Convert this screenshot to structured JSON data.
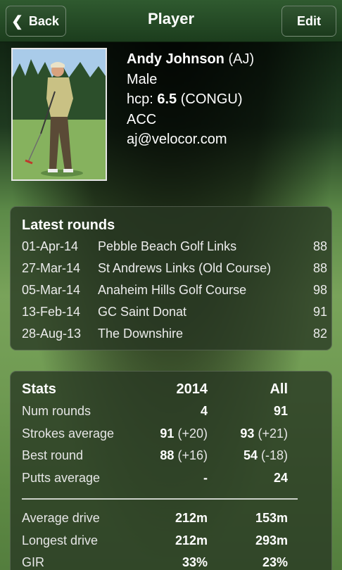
{
  "header": {
    "title": "Player",
    "back_label": "Back",
    "edit_label": "Edit"
  },
  "player": {
    "name": "Andy Johnson",
    "initials": "(AJ)",
    "gender": "Male",
    "hcp_label": "hcp:",
    "hcp_value": "6.5",
    "hcp_system": "(CONGU)",
    "club": "ACC",
    "email": "aj@velocor.com"
  },
  "latest_rounds": {
    "title": "Latest rounds",
    "rows": [
      {
        "date": "01-Apr-14",
        "course": "Pebble Beach Golf Links",
        "score": "88"
      },
      {
        "date": "27-Mar-14",
        "course": "St Andrews Links (Old Course)",
        "score": "88"
      },
      {
        "date": "05-Mar-14",
        "course": "Anaheim Hills Golf Course",
        "score": "98"
      },
      {
        "date": "13-Feb-14",
        "course": "GC Saint Donat",
        "score": "91"
      },
      {
        "date": "28-Aug-13",
        "course": "The Downshire",
        "score": "82"
      }
    ]
  },
  "stats": {
    "title": "Stats",
    "col1_header": "2014",
    "col2_header": "All",
    "rows": [
      {
        "label": "Num rounds",
        "c1_main": "4",
        "c1_extra": "",
        "c2_main": "91",
        "c2_extra": ""
      },
      {
        "label": "Strokes average",
        "c1_main": "91",
        "c1_extra": "(+20)",
        "c2_main": "93",
        "c2_extra": "(+21)"
      },
      {
        "label": "Best round",
        "c1_main": "88",
        "c1_extra": "(+16)",
        "c2_main": "54",
        "c2_extra": "(-18)"
      },
      {
        "label": "Putts average",
        "c1_main": "-",
        "c1_extra": "",
        "c2_main": "24",
        "c2_extra": ""
      }
    ],
    "rows2": [
      {
        "label": "Average drive",
        "c1": "212m",
        "c2": "153m"
      },
      {
        "label": "Longest drive",
        "c1": "212m",
        "c2": "293m"
      },
      {
        "label": "GIR",
        "c1": "33%",
        "c2": "23%"
      }
    ]
  },
  "colors": {
    "header_bg": "#1c3d1d",
    "card_bg": "#28372380"
  },
  "icons": {
    "back": "chevron-left-icon",
    "photo": "player-photo"
  }
}
